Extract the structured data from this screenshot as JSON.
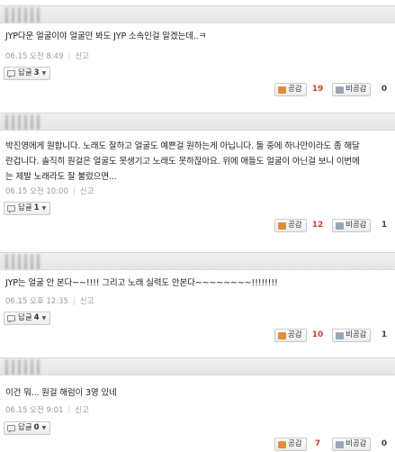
{
  "comments": [
    {
      "text": "JYP다운 얼굴이야 얼굴만 봐도 JYP 소속인걸 알겠는데..ㅋ",
      "date": "06.15 오전 8:49",
      "report_label": "신고",
      "reply_label": "답글",
      "reply_count": "3",
      "like_label": "공감",
      "like_count": "19",
      "dislike_label": "비공감",
      "dislike_count": "0"
    },
    {
      "text": "박진영에게 원합니다. 노래도 잘하고 얼굴도 예쁜걸 원하는게 아닙니다. 둘 중에 하나만이라도 좀 해달\n란겁니다. 솔직히 원걸은 얼굴도 못생기고 노래도 못하잖아요. 위에 애들도 얼굴이 아닌걸 보니 이번에\n는 제발 노래라도 잘 불렀으면...",
      "date": "06.15 오전 10:00",
      "report_label": "신고",
      "reply_label": "답글",
      "reply_count": "1",
      "like_label": "공감",
      "like_count": "12",
      "dislike_label": "비공감",
      "dislike_count": "1"
    },
    {
      "text": "JYP는 얼굴 안 본다~~!!!! 그리고 노래 실력도 안본다~~~~~~~~!!!!!!!!",
      "date": "06.15 오후 12:35",
      "report_label": "신고",
      "reply_label": "답글",
      "reply_count": "4",
      "like_label": "공감",
      "like_count": "10",
      "dislike_label": "비공감",
      "dislike_count": "1"
    },
    {
      "text": "이건 뭐... 원걸 해럼이 3명 있네",
      "date": "06.15 오전 9:01",
      "report_label": "신고",
      "reply_label": "답글",
      "reply_count": "0",
      "like_label": "공감",
      "like_count": "7",
      "dislike_label": "비공감",
      "dislike_count": "0"
    }
  ],
  "colors": {
    "like_count": "#d0412c",
    "header_bg": "#ececec",
    "meta_text": "#999999"
  },
  "icons": {
    "reply": "speech-bubble-icon",
    "like": "thumbs-up-icon",
    "dislike": "thumbs-down-icon"
  }
}
